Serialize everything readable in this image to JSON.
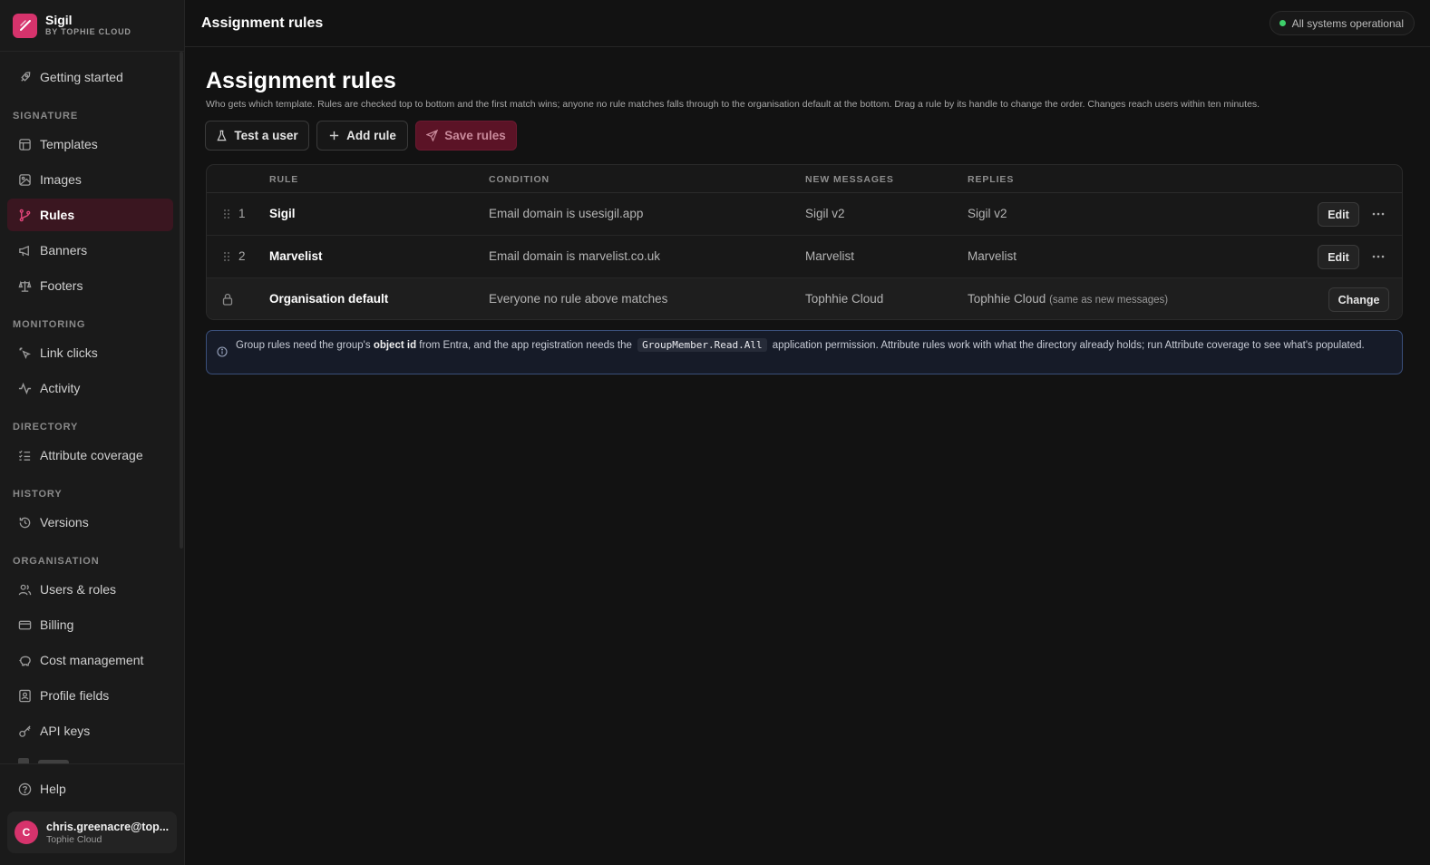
{
  "brand": {
    "name": "Sigil",
    "subtitle": "BY TOPHIE CLOUD"
  },
  "sidebar": {
    "getting_started": "Getting started",
    "sections": {
      "signature": "SIGNATURE",
      "monitoring": "MONITORING",
      "directory": "DIRECTORY",
      "history": "HISTORY",
      "organisation": "ORGANISATION"
    },
    "items": {
      "templates": "Templates",
      "images": "Images",
      "rules": "Rules",
      "banners": "Banners",
      "footers": "Footers",
      "link_clicks": "Link clicks",
      "activity": "Activity",
      "attribute_coverage": "Attribute coverage",
      "versions": "Versions",
      "users_roles": "Users & roles",
      "billing": "Billing",
      "cost_management": "Cost management",
      "profile_fields": "Profile fields",
      "api_keys": "API keys",
      "help": "Help"
    },
    "active_item": "Rules",
    "user": {
      "initial": "C",
      "email": "chris.greenacre@top...",
      "org": "Tophie Cloud"
    }
  },
  "topbar": {
    "title": "Assignment rules",
    "status": "All systems operational"
  },
  "page": {
    "title": "Assignment rules",
    "description": "Who gets which template. Rules are checked top to bottom and the first match wins; anyone no rule matches falls through to the organisation default at the bottom. Drag a rule by its handle to change the order. Changes reach users within ten minutes."
  },
  "actions": {
    "test_user": "Test a user",
    "add_rule": "Add rule",
    "save_rules": "Save rules"
  },
  "table": {
    "headers": {
      "rule": "RULE",
      "condition": "CONDITION",
      "new_messages": "NEW MESSAGES",
      "replies": "REPLIES"
    },
    "rows": [
      {
        "order": "1",
        "name": "Sigil",
        "condition": "Email domain is usesigil.app",
        "new_messages": "Sigil v2",
        "replies": "Sigil v2",
        "action": "Edit"
      },
      {
        "order": "2",
        "name": "Marvelist",
        "condition": "Email domain is marvelist.co.uk",
        "new_messages": "Marvelist",
        "replies": "Marvelist",
        "action": "Edit"
      }
    ],
    "default_row": {
      "name": "Organisation default",
      "condition": "Everyone no rule above matches",
      "new_messages": "Tophhie Cloud",
      "replies": "Tophhie Cloud",
      "replies_note": "(same as new messages)",
      "action": "Change"
    }
  },
  "info": {
    "text_1": "Group rules need the group's",
    "bold": "object id",
    "text_2": "from Entra, and the app registration needs the",
    "code": "GroupMember.Read.All",
    "text_3": "application permission. Attribute rules work with what the directory already holds; run Attribute coverage to see what's populated."
  },
  "colors": {
    "accent": "#d6336c",
    "status_ok": "#3ecf6a",
    "info_border": "#3a4f7a"
  }
}
